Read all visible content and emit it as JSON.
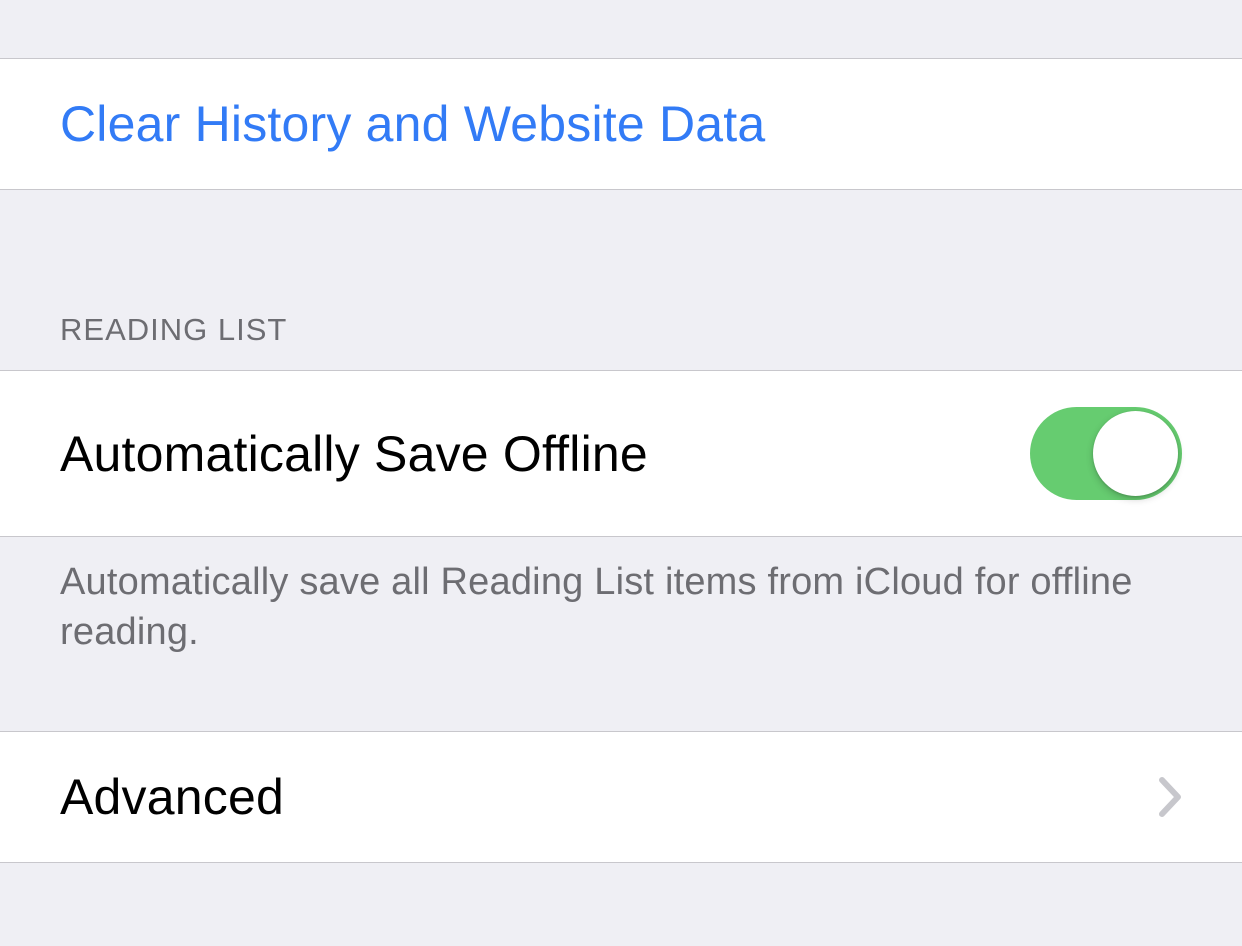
{
  "clear_section": {
    "label": "Clear History and Website Data"
  },
  "reading_list": {
    "header": "READING LIST",
    "toggle_label": "Automatically Save Offline",
    "toggle_on": true,
    "footer": "Automatically save all Reading List items from iCloud for offline reading."
  },
  "advanced": {
    "label": "Advanced"
  }
}
